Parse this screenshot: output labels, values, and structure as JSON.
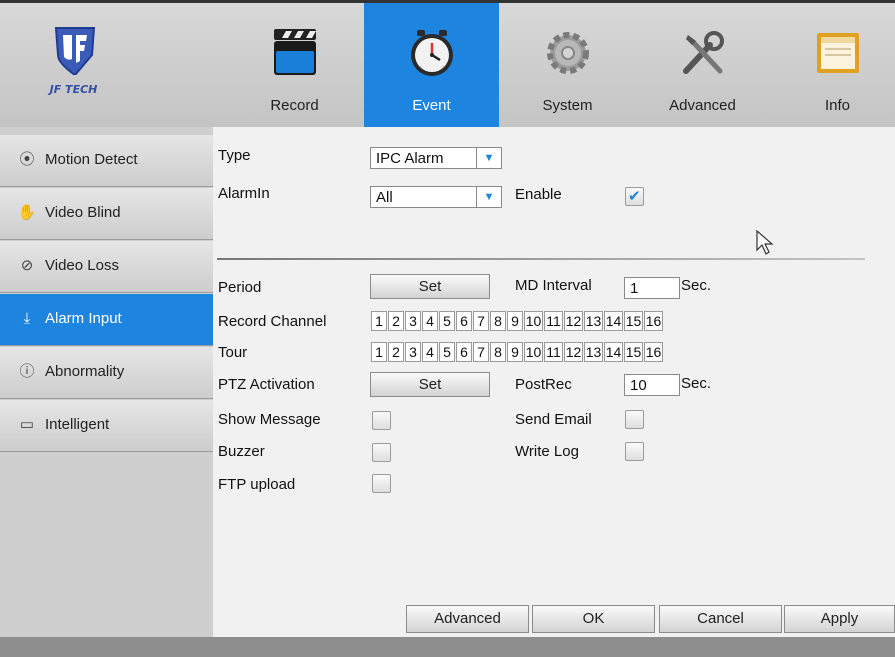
{
  "brand": {
    "logo_text": "JF TECH",
    "accent_color": "#1d84e0"
  },
  "tabs": [
    {
      "label": "Record",
      "icon": "clapperboard-icon",
      "active": false
    },
    {
      "label": "Event",
      "icon": "clock-icon",
      "active": true
    },
    {
      "label": "System",
      "icon": "gear-icon",
      "active": false
    },
    {
      "label": "Advanced",
      "icon": "tools-icon",
      "active": false
    },
    {
      "label": "Info",
      "icon": "monitor-icon",
      "active": false
    }
  ],
  "sidebar": {
    "items": [
      {
        "label": "Motion Detect",
        "icon": "motion-icon",
        "active": false
      },
      {
        "label": "Video Blind",
        "icon": "hand-icon",
        "active": false
      },
      {
        "label": "Video Loss",
        "icon": "no-signal-icon",
        "active": false
      },
      {
        "label": "Alarm Input",
        "icon": "download-icon",
        "active": true
      },
      {
        "label": "Abnormality",
        "icon": "info-icon",
        "active": false
      },
      {
        "label": "Intelligent",
        "icon": "monitor-small-icon",
        "active": false
      }
    ]
  },
  "form": {
    "type": {
      "label": "Type",
      "value": "IPC Alarm"
    },
    "alarmin": {
      "label": "AlarmIn",
      "value": "All"
    },
    "enable": {
      "label": "Enable",
      "checked": true
    },
    "period": {
      "label": "Period",
      "button": "Set"
    },
    "md_interval": {
      "label": "MD Interval",
      "value": "1",
      "unit": "Sec."
    },
    "record_channel": {
      "label": "Record Channel",
      "channels": [
        "1",
        "2",
        "3",
        "4",
        "5",
        "6",
        "7",
        "8",
        "9",
        "10",
        "11",
        "12",
        "13",
        "14",
        "15",
        "16"
      ]
    },
    "tour": {
      "label": "Tour",
      "channels": [
        "1",
        "2",
        "3",
        "4",
        "5",
        "6",
        "7",
        "8",
        "9",
        "10",
        "11",
        "12",
        "13",
        "14",
        "15",
        "16"
      ]
    },
    "ptz_activation": {
      "label": "PTZ Activation",
      "button": "Set"
    },
    "postrec": {
      "label": "PostRec",
      "value": "10",
      "unit": "Sec."
    },
    "show_message": {
      "label": "Show Message",
      "checked": false
    },
    "send_email": {
      "label": "Send Email",
      "checked": false
    },
    "buzzer": {
      "label": "Buzzer",
      "checked": false
    },
    "write_log": {
      "label": "Write Log",
      "checked": false
    },
    "ftp_upload": {
      "label": "FTP upload",
      "checked": false
    }
  },
  "footer": {
    "advanced": "Advanced",
    "ok": "OK",
    "cancel": "Cancel",
    "apply": "Apply"
  }
}
